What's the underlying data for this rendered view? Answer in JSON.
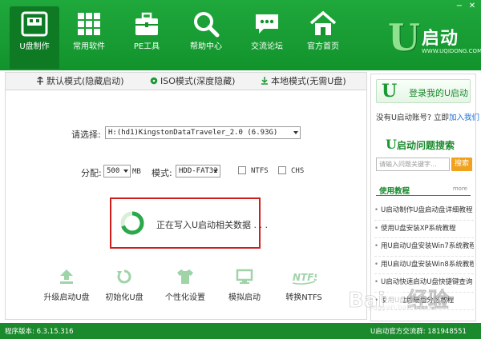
{
  "header": {
    "nav": [
      {
        "label": "U盘制作",
        "icon": "usb-drive-icon",
        "active": true
      },
      {
        "label": "常用软件",
        "icon": "grid-icon",
        "active": false
      },
      {
        "label": "PE工具",
        "icon": "toolbox-icon",
        "active": false
      },
      {
        "label": "帮助中心",
        "icon": "magnifier-icon",
        "active": false
      },
      {
        "label": "交流论坛",
        "icon": "chat-bubble-icon",
        "active": false
      },
      {
        "label": "官方首页",
        "icon": "home-icon",
        "active": false
      }
    ],
    "logo": {
      "letter": "U",
      "text": "启动",
      "url": "WWW.UQIDONG.COM"
    },
    "window_controls": {
      "minimize": "−",
      "close": "✕"
    }
  },
  "tabs": [
    {
      "label": "默认模式(隐藏启动)",
      "active": true
    },
    {
      "label": "ISO模式(深度隐藏)",
      "active": false
    },
    {
      "label": "本地模式(无需U盘)",
      "active": false
    }
  ],
  "form": {
    "device_label": "请选择:",
    "device_value": "H:(hd1)KingstonDataTraveler_2.0 (6.93G)",
    "partition_label": "分配:",
    "partition_value": "500",
    "partition_unit": "MB",
    "mode_label": "模式:",
    "mode_value": "HDD-FAT32",
    "ntfs_label": "NTFS",
    "chs_label": "CHS"
  },
  "progress": {
    "text": "正在写入U启动相关数据 . . ."
  },
  "actions": [
    {
      "label": "升级启动U盘",
      "icon": "upgrade-icon"
    },
    {
      "label": "初始化U盘",
      "icon": "reset-icon"
    },
    {
      "label": "个性化设置",
      "icon": "shirt-icon"
    },
    {
      "label": "模拟启动",
      "icon": "monitor-icon"
    },
    {
      "label": "转换NTFS",
      "icon": "ntfs-icon"
    }
  ],
  "sidebar": {
    "login_letter": "U",
    "login_label": "登录我的U启动",
    "signup_prefix": "没有U启动账号? 立即",
    "signup_link": "加入我们",
    "search_letter": "U",
    "search_title": "启动问题搜索",
    "search_placeholder": "请输入问题关键字...",
    "search_button": "搜索",
    "tutorial_title": "使用教程",
    "tutorial_more": "more",
    "tutorials": [
      "U启动制作U盘启动盘详细教程",
      "使用U盘安装XP系统教程",
      "用U启动U盘安装Win7系统教程",
      "用U启动U盘安装Win8系统教程",
      "U启动快速启动U盘快捷键查询",
      "使用U盘给硬盘分区教程"
    ]
  },
  "footer": {
    "version": "程序版本: 6.3.15.316",
    "qq_group": "U启动官方交流群: 181948551"
  },
  "watermark": {
    "text": "jingyan.baidu.com"
  },
  "colors": {
    "brand_green": "#1a9a33",
    "header_green": "#12932c",
    "highlight_red": "#d21d1d",
    "search_orange": "#f0a21c"
  }
}
